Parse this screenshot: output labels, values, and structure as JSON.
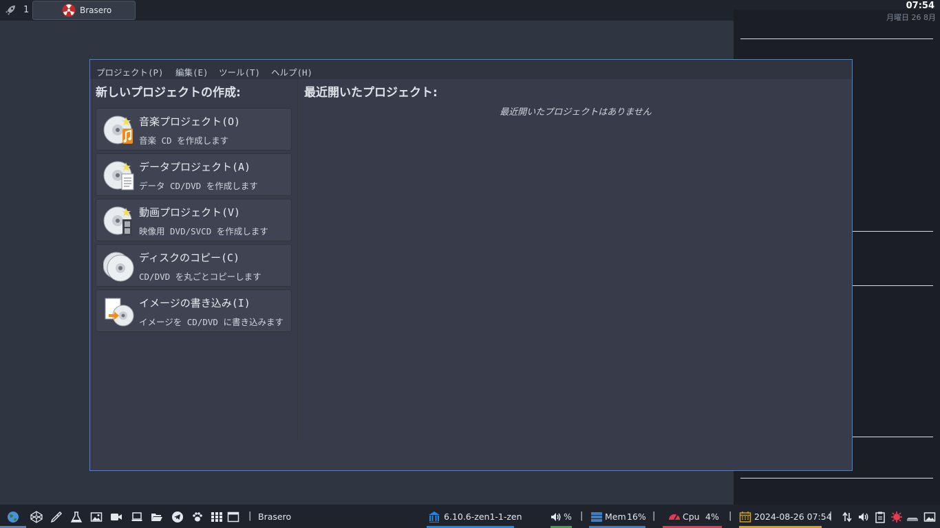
{
  "topbar": {
    "workspace_number": "1",
    "task_label": "Brasero"
  },
  "conky": {
    "time": "07:54",
    "date": "月曜日 26 8月"
  },
  "menu": [
    "プロジェクト(P)",
    "編集(E)",
    "ツール(T)",
    "ヘルプ(H)"
  ],
  "left": {
    "heading": "新しいプロジェクトの作成:",
    "projects": [
      {
        "title": "音楽プロジェクト(O)",
        "desc": "音楽 CD を作成します",
        "icon": "audio-disc-icon"
      },
      {
        "title": "データプロジェクト(A)",
        "desc": "データ CD/DVD を作成します",
        "icon": "data-disc-icon"
      },
      {
        "title": "動画プロジェクト(V)",
        "desc": "映像用 DVD/SVCD を作成します",
        "icon": "video-disc-icon"
      },
      {
        "title": "ディスクのコピー(C)",
        "desc": "CD/DVD を丸ごとコピーします",
        "icon": "disc-copy-icon"
      },
      {
        "title": "イメージの書き込み(I)",
        "desc": "イメージを CD/DVD に書き込みます",
        "icon": "image-burn-icon"
      }
    ]
  },
  "right": {
    "heading": "最近開いたプロジェクト:",
    "empty_text": "最近開いたプロジェクトはありません"
  },
  "bottombar": {
    "launchers": [
      "globe-icon",
      "codepen-icon",
      "eyedropper-icon",
      "flask-icon",
      "image-icon",
      "video-camera-icon",
      "laptop-icon",
      "folder-open-icon",
      "telegram-icon",
      "paw-icon",
      "grid-icon",
      "window-icon"
    ],
    "active_window": "Brasero",
    "kernel": "6.10.6-zen1-1-zen",
    "volume": "%",
    "mem_label": "Mem",
    "mem_value": "16%",
    "cpu_label": "Cpu",
    "cpu_value": "4%",
    "datetime": "2024-08-26 07:54",
    "separator": "|",
    "colors": {
      "kernel": "#1e88e5",
      "volume": "#43a047",
      "mem": "#3f7fbf",
      "cpu": "#e53950",
      "date": "#d4a017"
    }
  }
}
